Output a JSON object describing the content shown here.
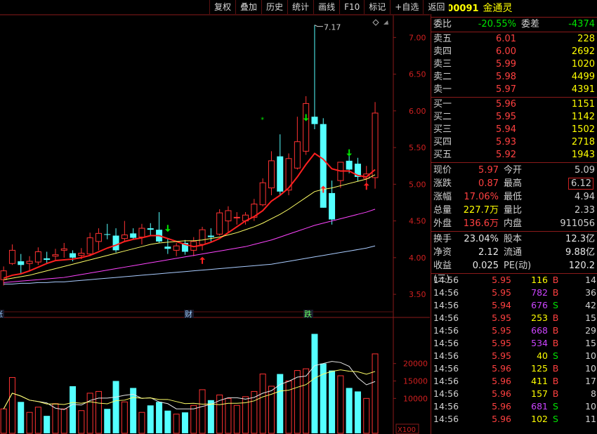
{
  "toolbar": [
    "复权",
    "叠加",
    "历史",
    "统计",
    "画线",
    "F10",
    "标记",
    "+自选",
    "返回"
  ],
  "stock": {
    "r_mark": "R",
    "code": "300091",
    "name": "金通灵"
  },
  "ratio": {
    "label1": "委比",
    "v1": "-20.55%",
    "label2": "委差",
    "v2": "-4374"
  },
  "asks": [
    {
      "label": "卖五",
      "price": "6.01",
      "vol": "228"
    },
    {
      "label": "卖四",
      "price": "6.00",
      "vol": "2692"
    },
    {
      "label": "卖三",
      "price": "5.99",
      "vol": "1020"
    },
    {
      "label": "卖二",
      "price": "5.98",
      "vol": "4499"
    },
    {
      "label": "卖一",
      "price": "5.97",
      "vol": "4391"
    }
  ],
  "bids": [
    {
      "label": "买一",
      "price": "5.96",
      "vol": "1151"
    },
    {
      "label": "买二",
      "price": "5.95",
      "vol": "1142"
    },
    {
      "label": "买三",
      "price": "5.94",
      "vol": "1502"
    },
    {
      "label": "买四",
      "price": "5.93",
      "vol": "2718"
    },
    {
      "label": "买五",
      "price": "5.92",
      "vol": "1943"
    }
  ],
  "quote1": [
    {
      "l1": "现价",
      "v1": "5.97",
      "c1": "red",
      "l2": "今开",
      "v2": "5.09",
      "c2": "green"
    },
    {
      "l1": "涨跌",
      "v1": "0.87",
      "c1": "red",
      "l2": "最高",
      "v2": "6.12",
      "c2": "red",
      "box2": true
    },
    {
      "l1": "涨幅",
      "v1": "17.06%",
      "c1": "red",
      "l2": "最低",
      "v2": "4.94",
      "c2": "green"
    },
    {
      "l1": "总量",
      "v1": "227.7万",
      "c1": "yellow",
      "l2": "量比",
      "v2": "2.33",
      "c2": "red"
    },
    {
      "l1": "外盘",
      "v1": "136.6万",
      "c1": "red",
      "l2": "内盘",
      "v2": "911056",
      "c2": "green"
    }
  ],
  "quote2": [
    {
      "l1": "换手",
      "v1": "23.04%",
      "l2": "股本",
      "v2": "12.3亿"
    },
    {
      "l1": "净资",
      "v1": "2.12",
      "l2": "流通",
      "v2": "9.88亿"
    },
    {
      "l1": "收益(三)",
      "v1": "0.025",
      "l2": "PE(动)",
      "v2": "120.2"
    }
  ],
  "ticks": [
    {
      "t": "14:56",
      "p": "5.95",
      "v": "116",
      "vc": "yellow",
      "s": "B",
      "n": "14"
    },
    {
      "t": "14:56",
      "p": "5.95",
      "v": "782",
      "vc": "purple",
      "s": "B",
      "n": "36"
    },
    {
      "t": "14:56",
      "p": "5.94",
      "v": "676",
      "vc": "purple",
      "s": "S",
      "n": "42"
    },
    {
      "t": "14:56",
      "p": "5.95",
      "v": "253",
      "vc": "yellow",
      "s": "B",
      "n": "15"
    },
    {
      "t": "14:56",
      "p": "5.95",
      "v": "668",
      "vc": "purple",
      "s": "B",
      "n": "29"
    },
    {
      "t": "14:56",
      "p": "5.95",
      "v": "534",
      "vc": "purple",
      "s": "B",
      "n": "15"
    },
    {
      "t": "14:56",
      "p": "5.95",
      "v": "40",
      "vc": "yellow",
      "s": "S",
      "n": "10"
    },
    {
      "t": "14:56",
      "p": "5.96",
      "v": "125",
      "vc": "yellow",
      "s": "B",
      "n": "10"
    },
    {
      "t": "14:56",
      "p": "5.96",
      "v": "411",
      "vc": "yellow",
      "s": "B",
      "n": "17"
    },
    {
      "t": "14:56",
      "p": "5.96",
      "v": "157",
      "vc": "yellow",
      "s": "B",
      "n": "8"
    },
    {
      "t": "14:56",
      "p": "5.96",
      "v": "681",
      "vc": "purple",
      "s": "S",
      "n": "10"
    },
    {
      "t": "14:56",
      "p": "5.96",
      "v": "102",
      "vc": "yellow",
      "s": "S",
      "n": "11"
    }
  ],
  "chart_data": {
    "type": "candlestick",
    "price_axis": [
      "7.00",
      "6.50",
      "6.00",
      "5.50",
      "5.00",
      "4.50",
      "4.00",
      "3.50"
    ],
    "price_ylim": [
      3.3,
      7.3
    ],
    "volume_axis": [
      "20000",
      "15000",
      "10000"
    ],
    "volume_unit": "X100",
    "high_annotation": "7.17",
    "markers": [
      "涨",
      "财",
      "跌"
    ],
    "candles": [
      {
        "o": 3.7,
        "h": 3.88,
        "l": 3.62,
        "c": 3.82,
        "v": 7000
      },
      {
        "o": 3.92,
        "h": 4.18,
        "l": 3.9,
        "c": 4.1,
        "v": 16000
      },
      {
        "o": 3.95,
        "h": 4.05,
        "l": 3.78,
        "c": 3.9,
        "v": 9000
      },
      {
        "o": 3.92,
        "h": 4.02,
        "l": 3.82,
        "c": 3.95,
        "v": 6000
      },
      {
        "o": 3.94,
        "h": 4.14,
        "l": 3.9,
        "c": 4.08,
        "v": 7500
      },
      {
        "o": 3.99,
        "h": 4.08,
        "l": 3.92,
        "c": 3.97,
        "v": 5000
      },
      {
        "o": 4.02,
        "h": 4.12,
        "l": 3.97,
        "c": 4.04,
        "v": 8500
      },
      {
        "o": 4.1,
        "h": 4.2,
        "l": 4.0,
        "c": 4.12,
        "v": 7000
      },
      {
        "o": 4.06,
        "h": 4.1,
        "l": 3.95,
        "c": 4.0,
        "v": 13500
      },
      {
        "o": 4.03,
        "h": 4.13,
        "l": 3.98,
        "c": 4.06,
        "v": 6500
      },
      {
        "o": 4.05,
        "h": 4.34,
        "l": 4.02,
        "c": 4.27,
        "v": 11500
      },
      {
        "o": 4.22,
        "h": 4.4,
        "l": 4.1,
        "c": 4.33,
        "v": 12000
      },
      {
        "o": 4.32,
        "h": 4.46,
        "l": 4.25,
        "c": 4.31,
        "v": 7000
      },
      {
        "o": 4.3,
        "h": 4.4,
        "l": 4.07,
        "c": 4.1,
        "v": 15000
      },
      {
        "o": 4.26,
        "h": 4.5,
        "l": 4.22,
        "c": 4.31,
        "v": 9000
      },
      {
        "o": 4.33,
        "h": 4.4,
        "l": 4.25,
        "c": 4.27,
        "v": 13000
      },
      {
        "o": 4.28,
        "h": 4.46,
        "l": 4.18,
        "c": 4.4,
        "v": 6000
      },
      {
        "o": 4.4,
        "h": 4.47,
        "l": 4.3,
        "c": 4.38,
        "v": 8000
      },
      {
        "o": 4.38,
        "h": 4.62,
        "l": 4.2,
        "c": 4.22,
        "v": 9000
      },
      {
        "o": 4.15,
        "h": 4.26,
        "l": 4.05,
        "c": 4.12,
        "v": 6500
      },
      {
        "o": 4.1,
        "h": 4.2,
        "l": 4.02,
        "c": 4.16,
        "v": 5500
      },
      {
        "o": 4.2,
        "h": 4.24,
        "l": 4.04,
        "c": 4.08,
        "v": 6000
      },
      {
        "o": 4.1,
        "h": 4.28,
        "l": 4.02,
        "c": 4.22,
        "v": 8000
      },
      {
        "o": 4.18,
        "h": 4.42,
        "l": 4.1,
        "c": 4.38,
        "v": 12500
      },
      {
        "o": 4.3,
        "h": 4.4,
        "l": 4.22,
        "c": 4.28,
        "v": 9500
      },
      {
        "o": 4.32,
        "h": 4.66,
        "l": 4.3,
        "c": 4.61,
        "v": 11000
      },
      {
        "o": 4.5,
        "h": 4.7,
        "l": 4.35,
        "c": 4.64,
        "v": 10000
      },
      {
        "o": 4.55,
        "h": 4.62,
        "l": 4.45,
        "c": 4.55,
        "v": 8000
      },
      {
        "o": 4.5,
        "h": 4.62,
        "l": 4.45,
        "c": 4.58,
        "v": 10500
      },
      {
        "o": 4.55,
        "h": 4.8,
        "l": 4.5,
        "c": 4.73,
        "v": 12000
      },
      {
        "o": 4.72,
        "h": 5.08,
        "l": 4.7,
        "c": 5.02,
        "v": 17000
      },
      {
        "o": 4.95,
        "h": 5.45,
        "l": 4.85,
        "c": 5.32,
        "v": 13500
      },
      {
        "o": 5.38,
        "h": 5.68,
        "l": 4.85,
        "c": 4.9,
        "v": 17000
      },
      {
        "o": 4.92,
        "h": 5.42,
        "l": 4.85,
        "c": 5.35,
        "v": 15000
      },
      {
        "o": 5.22,
        "h": 5.92,
        "l": 5.2,
        "c": 5.58,
        "v": 18000
      },
      {
        "o": 5.45,
        "h": 6.2,
        "l": 5.4,
        "c": 6.1,
        "v": 18500
      },
      {
        "o": 5.92,
        "h": 7.17,
        "l": 5.75,
        "c": 5.82,
        "v": 28500
      },
      {
        "o": 5.82,
        "h": 5.9,
        "l": 4.68,
        "c": 4.68,
        "v": 20000
      },
      {
        "o": 4.88,
        "h": 5.05,
        "l": 4.45,
        "c": 4.52,
        "v": 18000
      },
      {
        "o": 5.05,
        "h": 5.3,
        "l": 4.95,
        "c": 5.3,
        "v": 16500
      },
      {
        "o": 5.32,
        "h": 5.45,
        "l": 5.15,
        "c": 5.2,
        "v": 13000
      },
      {
        "o": 5.28,
        "h": 5.36,
        "l": 5.04,
        "c": 5.1,
        "v": 12000
      },
      {
        "o": 5.08,
        "h": 5.25,
        "l": 4.98,
        "c": 5.14,
        "v": 10000
      },
      {
        "o": 5.09,
        "h": 6.12,
        "l": 4.94,
        "c": 5.97,
        "v": 22770
      }
    ],
    "ma": [
      {
        "name": "MA5",
        "color": "#ff2020",
        "values": [
          3.72,
          3.76,
          3.78,
          3.82,
          3.87,
          3.92,
          3.96,
          3.97,
          3.98,
          4.0,
          4.03,
          4.08,
          4.13,
          4.17,
          4.22,
          4.25,
          4.27,
          4.3,
          4.3,
          4.26,
          4.22,
          4.18,
          4.15,
          4.17,
          4.21,
          4.26,
          4.34,
          4.42,
          4.5,
          4.56,
          4.64,
          4.77,
          4.85,
          4.95,
          5.1,
          5.27,
          5.42,
          5.34,
          5.21,
          5.18,
          5.18,
          5.12,
          5.1,
          5.2
        ]
      },
      {
        "name": "MA10",
        "color": "#ffff66",
        "values": [
          3.7,
          3.72,
          3.74,
          3.76,
          3.79,
          3.82,
          3.85,
          3.88,
          3.91,
          3.94,
          3.97,
          4.0,
          4.03,
          4.06,
          4.09,
          4.12,
          4.15,
          4.18,
          4.2,
          4.21,
          4.22,
          4.23,
          4.23,
          4.24,
          4.26,
          4.28,
          4.31,
          4.34,
          4.38,
          4.42,
          4.47,
          4.53,
          4.59,
          4.66,
          4.74,
          4.82,
          4.9,
          4.93,
          4.95,
          4.98,
          5.01,
          5.04,
          5.07,
          5.13
        ]
      },
      {
        "name": "MA20",
        "color": "#ff44ff",
        "values": [
          3.66,
          3.67,
          3.68,
          3.69,
          3.7,
          3.71,
          3.72,
          3.73,
          3.75,
          3.77,
          3.79,
          3.81,
          3.83,
          3.85,
          3.87,
          3.89,
          3.91,
          3.93,
          3.95,
          3.97,
          3.99,
          4.01,
          4.03,
          4.05,
          4.07,
          4.09,
          4.11,
          4.13,
          4.15,
          4.18,
          4.21,
          4.24,
          4.28,
          4.32,
          4.36,
          4.4,
          4.44,
          4.47,
          4.5,
          4.53,
          4.56,
          4.59,
          4.62,
          4.66
        ]
      },
      {
        "name": "MA60",
        "color": "#aaccff",
        "values": [
          3.64,
          3.64,
          3.65,
          3.65,
          3.66,
          3.66,
          3.67,
          3.67,
          3.68,
          3.69,
          3.7,
          3.71,
          3.72,
          3.73,
          3.74,
          3.75,
          3.76,
          3.77,
          3.78,
          3.79,
          3.8,
          3.81,
          3.82,
          3.83,
          3.84,
          3.85,
          3.86,
          3.87,
          3.88,
          3.89,
          3.9,
          3.91,
          3.93,
          3.95,
          3.97,
          3.99,
          4.01,
          4.03,
          4.05,
          4.07,
          4.09,
          4.11,
          4.13,
          4.16
        ]
      }
    ]
  }
}
